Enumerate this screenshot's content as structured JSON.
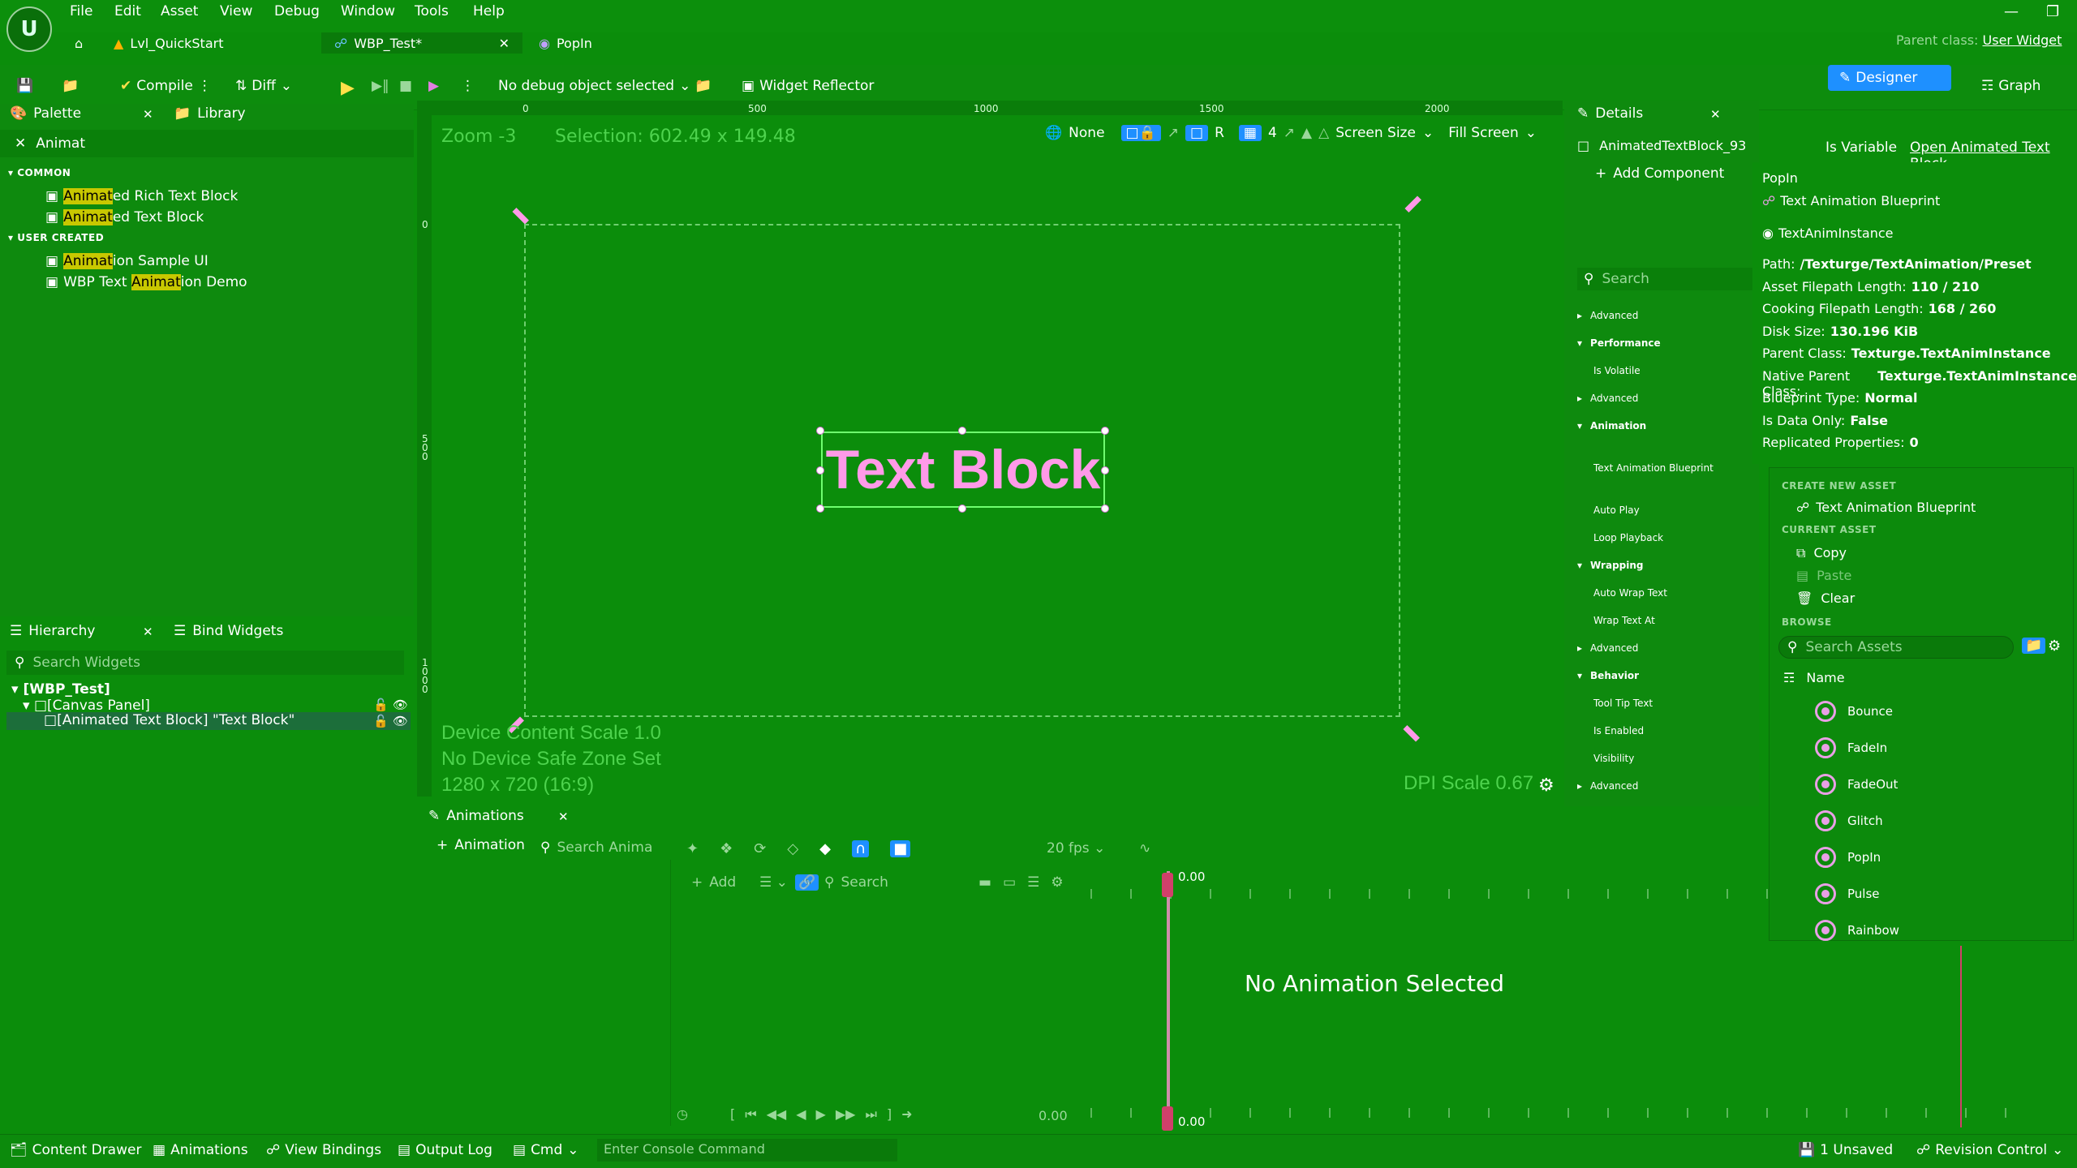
{
  "menu": [
    "File",
    "Edit",
    "Asset",
    "View",
    "Debug",
    "Window",
    "Tools",
    "Help"
  ],
  "doc_tabs": {
    "level": "Lvl_QuickStart",
    "widget": "WBP_Test*",
    "popin": "PopIn"
  },
  "parent_class": {
    "label": "Parent class:",
    "value": "User Widget"
  },
  "toolbar": {
    "compile": "Compile",
    "diff": "Diff",
    "debug_object": "No debug object selected",
    "widget_reflector": "Widget Reflector",
    "designer": "Designer",
    "graph": "Graph"
  },
  "palette": {
    "tab": "Palette",
    "library_tab": "Library",
    "search_value": "Animat",
    "sections": [
      {
        "name": "COMMON",
        "items": [
          {
            "pre": "",
            "hl": "Animat",
            "post": "ed Rich Text Block"
          },
          {
            "pre": "",
            "hl": "Animat",
            "post": "ed Text Block"
          }
        ]
      },
      {
        "name": "USER CREATED",
        "items": [
          {
            "pre": "",
            "hl": "Animat",
            "post": "ion Sample UI"
          },
          {
            "pre": "WBP Text ",
            "hl": "Animat",
            "post": "ion Demo"
          }
        ]
      }
    ]
  },
  "hierarchy": {
    "tab": "Hierarchy",
    "bind_tab": "Bind Widgets",
    "search_placeholder": "Search Widgets",
    "root": "[WBP_Test]",
    "canvas": "[Canvas Panel]",
    "selected": "[Animated Text Block] \"Text Block\""
  },
  "viewport": {
    "zoom": "Zoom -3",
    "selection": "Selection: 602.49 x 149.48",
    "none": "None",
    "r": "R",
    "grid": "4",
    "screen_size": "Screen Size",
    "fill_screen": "Fill Screen",
    "text_block": "Text Block",
    "device_scale": "Device Content Scale 1.0",
    "safe_zone": "No Device Safe Zone Set",
    "resolution": "1280 x 720 (16:9)",
    "dpi": "DPI Scale 0.67",
    "ruler_top": [
      "0",
      "500",
      "1000",
      "1500",
      "2000"
    ],
    "ruler_left": [
      "0",
      "5\n0\n0",
      "1\n0\n0\n0"
    ]
  },
  "animations": {
    "tab": "Animations",
    "add_animation": "Animation",
    "search_placeholder": "Search Anima",
    "fps": "20 fps",
    "add": "Add",
    "search2": "Search",
    "time_top": "0.00",
    "time_bottom": "0.00",
    "time_left": "0.00",
    "empty": "No Animation Selected"
  },
  "details": {
    "tab": "Details",
    "object": "AnimatedTextBlock_93",
    "is_variable": "Is Variable",
    "open_link": "Open Animated Text Block",
    "add_component": "Add Component",
    "search_placeholder": "Search",
    "props": [
      {
        "t": "sec",
        "label": "Advanced",
        "open": false
      },
      {
        "t": "sec",
        "label": "Performance",
        "open": true
      },
      {
        "t": "prop",
        "label": "Is Volatile"
      },
      {
        "t": "sec",
        "label": "Advanced",
        "open": false
      },
      {
        "t": "sec",
        "label": "Animation",
        "open": true
      },
      {
        "t": "prop",
        "label": "Text Animation Blueprint"
      },
      {
        "t": "prop",
        "label": "Auto Play"
      },
      {
        "t": "prop",
        "label": "Loop Playback"
      },
      {
        "t": "sec",
        "label": "Wrapping",
        "open": true
      },
      {
        "t": "prop",
        "label": "Auto Wrap Text"
      },
      {
        "t": "prop",
        "label": "Wrap Text At"
      },
      {
        "t": "sec",
        "label": "Advanced",
        "open": false
      },
      {
        "t": "sec",
        "label": "Behavior",
        "open": true
      },
      {
        "t": "prop",
        "label": "Tool Tip Text"
      },
      {
        "t": "prop",
        "label": "Is Enabled"
      },
      {
        "t": "prop",
        "label": "Visibility"
      },
      {
        "t": "sec",
        "label": "Advanced",
        "open": false
      }
    ]
  },
  "tooltip": {
    "title": "PopIn",
    "type": "Text Animation Blueprint",
    "instance": "TextAnimInstance",
    "lines": [
      {
        "k": "Path:",
        "v": "/Texturge/TextAnimation/Preset"
      },
      {
        "k": "Asset Filepath Length:",
        "v": "110 / 210"
      },
      {
        "k": "Cooking Filepath Length:",
        "v": "168 / 260"
      },
      {
        "k": "Disk Size:",
        "v": "130.196 KiB"
      },
      {
        "k": "Parent Class:",
        "v": "Texturge.TextAnimInstance"
      },
      {
        "k": "Native Parent Class:",
        "v": "Texturge.TextAnimInstance"
      },
      {
        "k": "Blueprint Type:",
        "v": "Normal"
      },
      {
        "k": "Is Data Only:",
        "v": "False"
      },
      {
        "k": "Replicated Properties:",
        "v": "0"
      }
    ]
  },
  "picker": {
    "create_header": "CREATE NEW ASSET",
    "create_item": "Text Animation Blueprint",
    "current_header": "CURRENT ASSET",
    "copy": "Copy",
    "paste": "Paste",
    "clear": "Clear",
    "browse_header": "BROWSE",
    "search_placeholder": "Search Assets",
    "name_col": "Name",
    "assets": [
      "Bounce",
      "FadeIn",
      "FadeOut",
      "Glitch",
      "PopIn",
      "Pulse",
      "Rainbow"
    ]
  },
  "statusbar": {
    "content_drawer": "Content Drawer",
    "animations": "Animations",
    "view_bindings": "View Bindings",
    "output_log": "Output Log",
    "cmd": "Cmd",
    "console_placeholder": "Enter Console Command",
    "unsaved": "1 Unsaved",
    "revision": "Revision Control"
  }
}
